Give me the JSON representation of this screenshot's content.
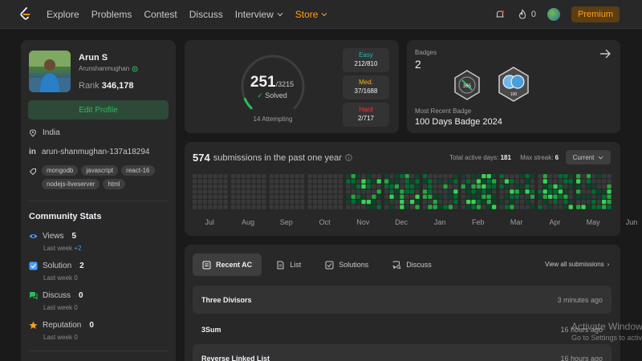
{
  "nav": {
    "items": [
      "Explore",
      "Problems",
      "Contest",
      "Discuss",
      "Interview",
      "Store"
    ],
    "fire_count": "0",
    "premium_label": "Premium"
  },
  "profile": {
    "name": "Arun S",
    "handle": "Arunshanmughan",
    "rank_label": "Rank",
    "rank_value": "346,178",
    "edit_label": "Edit Profile",
    "location": "India",
    "linkedin": "arun-shanmughan-137a18294",
    "tags": [
      "mongodb",
      "javascript",
      "react-16",
      "nodejs-liveserver",
      "html"
    ]
  },
  "community": {
    "title": "Community Stats",
    "last_week_label": "Last week",
    "stats": [
      {
        "label": "Views",
        "value": "5",
        "delta": "+2"
      },
      {
        "label": "Solution",
        "value": "2",
        "delta": "0"
      },
      {
        "label": "Discuss",
        "value": "0",
        "delta": "0"
      },
      {
        "label": "Reputation",
        "value": "0",
        "delta": "0"
      }
    ]
  },
  "solved": {
    "count": "251",
    "total": "/3215",
    "label": "Solved",
    "attempting": "14 Attempting",
    "progress": 0.078,
    "difficulties": [
      {
        "label": "Easy",
        "value": "212/810",
        "color": "#1cbaba"
      },
      {
        "label": "Med.",
        "value": "37/1688",
        "color": "#ffb700"
      },
      {
        "label": "Hard",
        "value": "2/717",
        "color": "#f63737"
      }
    ]
  },
  "badges": {
    "label": "Badges",
    "count": "2",
    "recent_label": "Most Recent Badge",
    "recent_name": "100 Days Badge 2024",
    "badge1_text": "365",
    "badge2_text": "100"
  },
  "submissions": {
    "count": "574",
    "text": "submissions in the past one year",
    "active_label": "Total active days:",
    "active_value": "181",
    "streak_label": "Max streak:",
    "streak_value": "6",
    "current_label": "Current",
    "months": [
      "Jul",
      "Aug",
      "Sep",
      "Oct",
      "Nov",
      "Dec",
      "Jan",
      "Feb",
      "Mar",
      "Apr",
      "May",
      "Jun"
    ]
  },
  "recent": {
    "tabs": [
      "Recent AC",
      "List",
      "Solutions",
      "Discuss"
    ],
    "view_all": "View all submissions",
    "rows": [
      {
        "title": "Three Divisors",
        "time": "3 minutes ago"
      },
      {
        "title": "3Sum",
        "time": "16 hours ago"
      },
      {
        "title": "Reverse Linked List",
        "time": "16 hours ago"
      }
    ]
  },
  "watermark": {
    "line1": "Activate Windows",
    "line2": "Go to Settings to activate Windows."
  }
}
